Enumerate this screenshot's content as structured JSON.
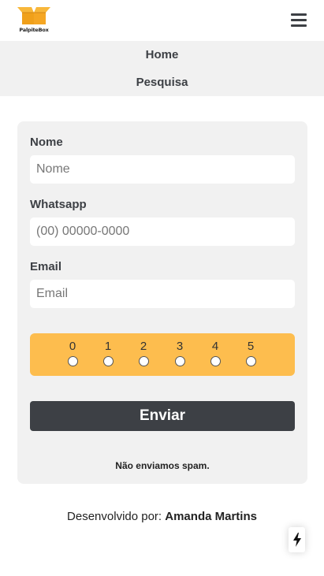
{
  "brand": {
    "name": "PalpiteBox",
    "accent_color": "#fdbd4e"
  },
  "header": {
    "menu_icon": "hamburger-menu-icon"
  },
  "nav": {
    "items": [
      {
        "label": "Home"
      },
      {
        "label": "Pesquisa"
      }
    ]
  },
  "form": {
    "fields": [
      {
        "label": "Nome",
        "placeholder": "Nome"
      },
      {
        "label": "Whatsapp",
        "placeholder": "(00) 00000-0000"
      },
      {
        "label": "Email",
        "placeholder": "Email"
      }
    ],
    "rating": {
      "options": [
        "0",
        "1",
        "2",
        "3",
        "4",
        "5"
      ],
      "selected": null
    },
    "submit_label": "Enviar",
    "spam_note": "Não enviamos spam."
  },
  "footer": {
    "prefix": "Desenvolvido por:",
    "author": "Amanda Martins"
  },
  "floating": {
    "icon": "lightning-bolt-icon"
  }
}
